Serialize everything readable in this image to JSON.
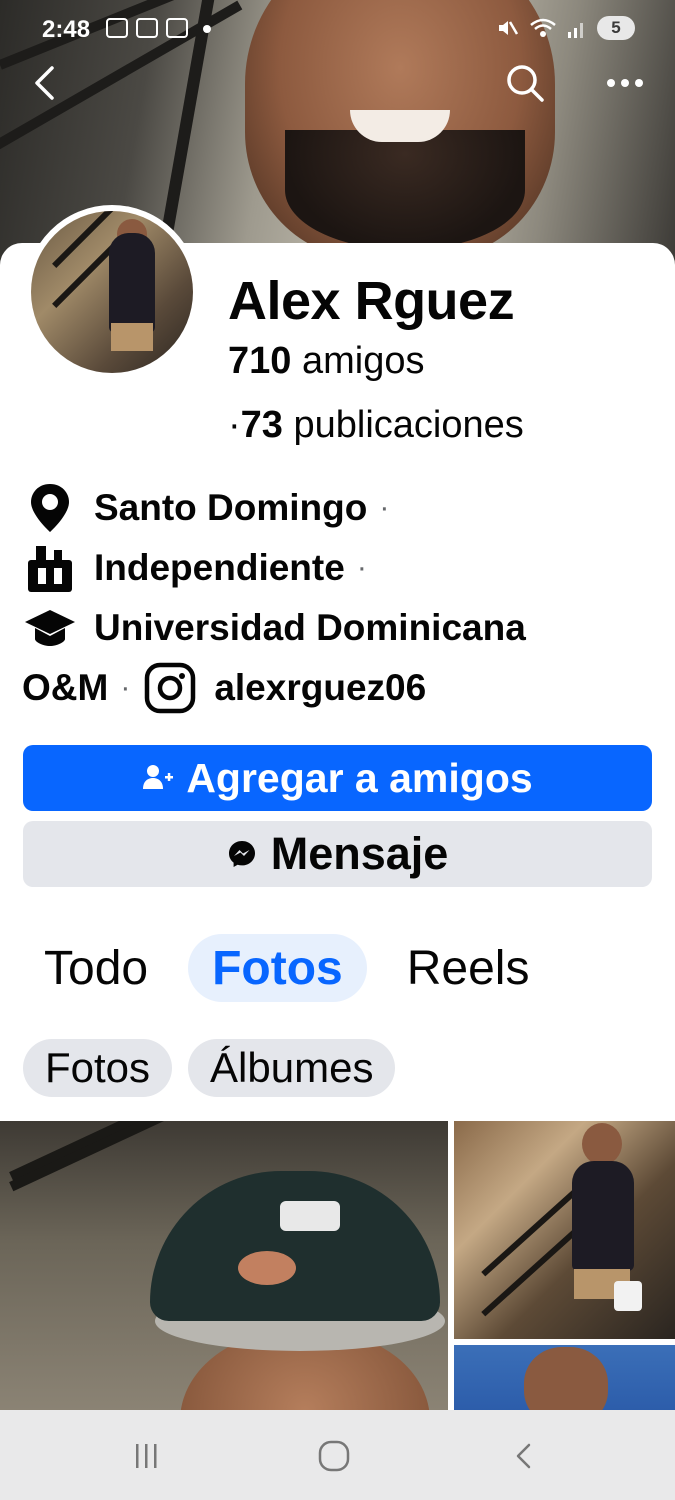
{
  "status_bar": {
    "time": "2:48",
    "battery": "5"
  },
  "profile": {
    "name": "Alex Rguez",
    "friends_count": "710",
    "friends_label": "amigos",
    "posts_prefix": "·",
    "posts_count": "73",
    "posts_label": "publicaciones"
  },
  "details": {
    "location": "Santo Domingo",
    "work": "Independiente",
    "education_line1": "Universidad Dominicana",
    "education_line2": "O&M",
    "instagram": "alexrguez06",
    "separator": "·"
  },
  "actions": {
    "add_friend": "Agregar a amigos",
    "message": "Mensaje"
  },
  "tabs": [
    {
      "label": "Todo",
      "active": false
    },
    {
      "label": "Fotos",
      "active": true
    },
    {
      "label": "Reels",
      "active": false
    }
  ],
  "subtabs": [
    {
      "label": "Fotos"
    },
    {
      "label": "Álbumes"
    }
  ],
  "colors": {
    "primary": "#0866ff",
    "secondary_button": "#e4e6eb",
    "active_tab_bg": "#e7f0fd",
    "text": "#050505"
  }
}
